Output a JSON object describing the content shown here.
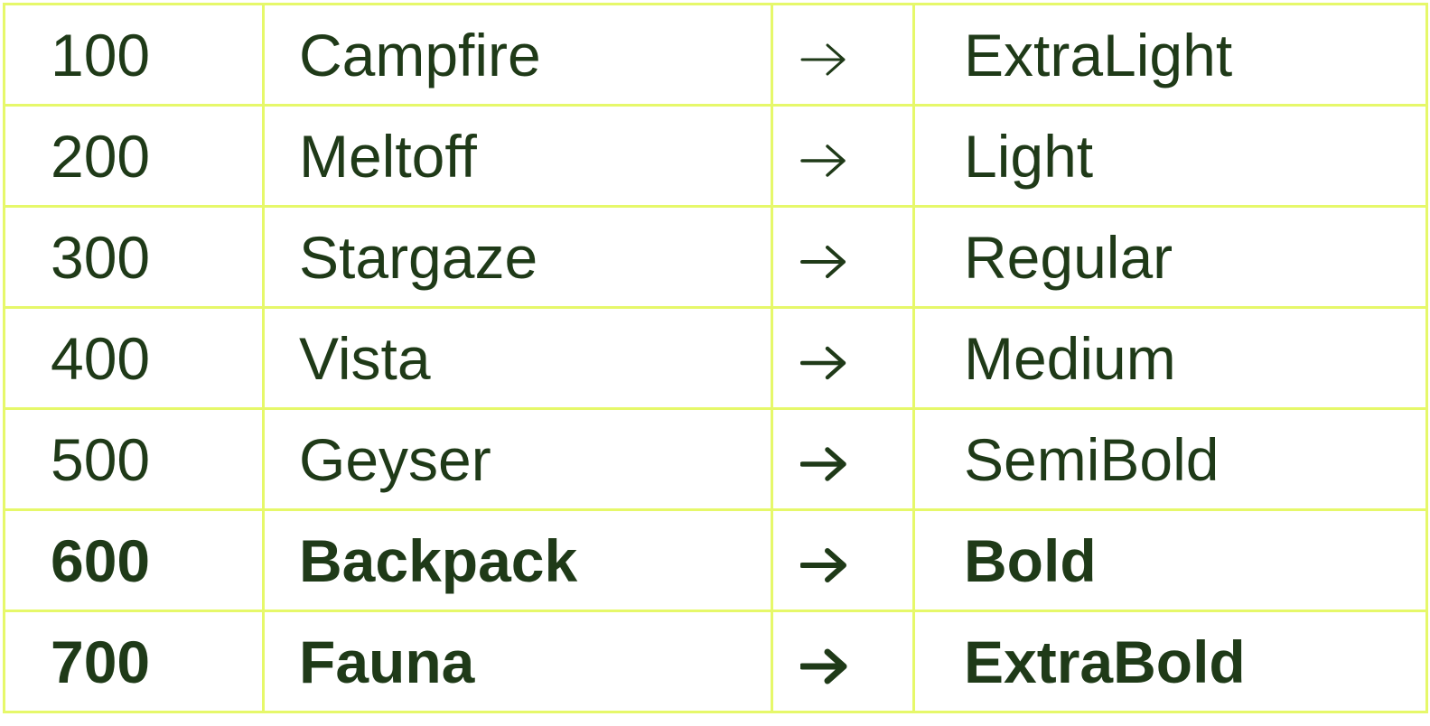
{
  "colors": {
    "text": "#1f3a18",
    "grid": "#e6f86a",
    "background": "#ffffff"
  },
  "arrow_icon": "right-arrow-icon",
  "rows": [
    {
      "weight": "100",
      "name": "Campfire",
      "style": "ExtraLight"
    },
    {
      "weight": "200",
      "name": "Meltoff",
      "style": "Light"
    },
    {
      "weight": "300",
      "name": "Stargaze",
      "style": "Regular"
    },
    {
      "weight": "400",
      "name": "Vista",
      "style": "Medium"
    },
    {
      "weight": "500",
      "name": "Geyser",
      "style": "SemiBold"
    },
    {
      "weight": "600",
      "name": "Backpack",
      "style": "Bold"
    },
    {
      "weight": "700",
      "name": "Fauna",
      "style": "ExtraBold"
    }
  ]
}
